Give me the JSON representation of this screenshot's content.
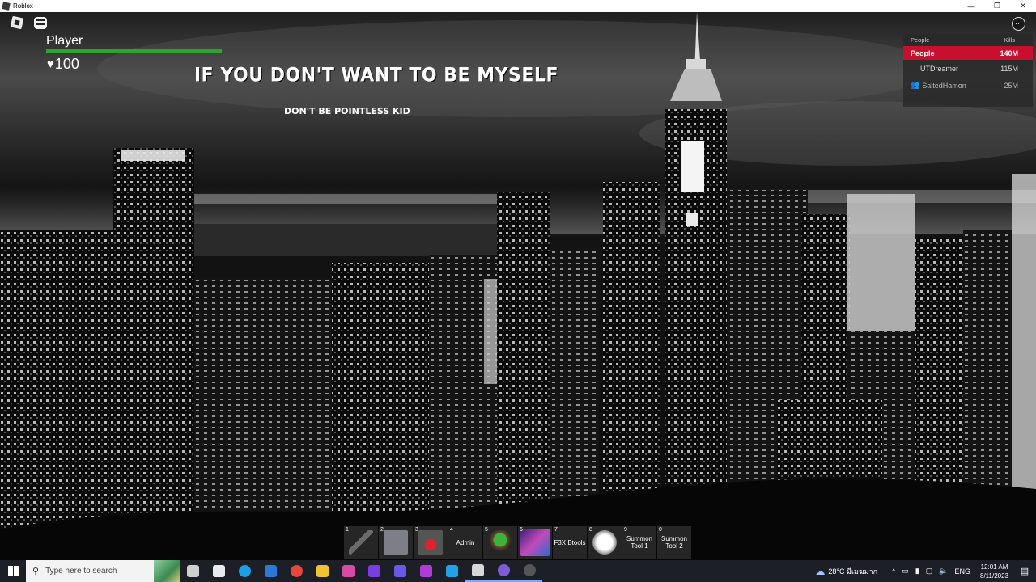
{
  "window": {
    "title": "Roblox",
    "minimize": "—",
    "restore": "❐",
    "close": "✕"
  },
  "hud": {
    "player_name": "Player",
    "health_value": "100",
    "health_fraction": 1.0,
    "heart": "♥",
    "headline": "IF YOU DON'T WANT TO BE MYSELF",
    "subline": "DON'T BE POINTLESS KID",
    "more_icon": "⋯"
  },
  "leaderboard": {
    "col_player": "People",
    "col_stat": "Kills",
    "rows": [
      {
        "name": "People",
        "value": "140M",
        "self": true
      },
      {
        "name": "UTDreamer",
        "value": "115M"
      },
      {
        "name": "SaltedHamon",
        "value": "25M",
        "friend_icon": "friends-icon"
      }
    ]
  },
  "hotbar": [
    {
      "num": "1",
      "label": "",
      "art": "#6b6b6b"
    },
    {
      "num": "2",
      "label": "",
      "art": "#7e7e86"
    },
    {
      "num": "3",
      "label": "",
      "art": "#b31e2a"
    },
    {
      "num": "4",
      "label": "Admin",
      "art": ""
    },
    {
      "num": "5",
      "label": "",
      "art": "#3a7a2e"
    },
    {
      "num": "6",
      "label": "",
      "art": "#a23ca8"
    },
    {
      "num": "7",
      "label": "F3X Btools",
      "art": ""
    },
    {
      "num": "8",
      "label": "",
      "art": "#f4f4f4"
    },
    {
      "num": "9",
      "label": "Summon Tool 1",
      "art": ""
    },
    {
      "num": "0",
      "label": "Summon Tool 2",
      "art": ""
    }
  ],
  "taskbar": {
    "search_placeholder": "Type here to search",
    "apps": [
      {
        "name": "task-view",
        "color": "#cfcfcf"
      },
      {
        "name": "microsoft-store",
        "color": "#e9e9e9"
      },
      {
        "name": "edge",
        "color": "#1aa0e6"
      },
      {
        "name": "mail",
        "color": "#2a7ad9"
      },
      {
        "name": "chrome",
        "color": "#e8453c"
      },
      {
        "name": "file-explorer",
        "color": "#f2c233"
      },
      {
        "name": "color-drop-app",
        "color": "#d94aa7"
      },
      {
        "name": "video-editor",
        "color": "#7a3ee0"
      },
      {
        "name": "media-player",
        "color": "#6a5ae8"
      },
      {
        "name": "purple-app",
        "color": "#b03cd8"
      },
      {
        "name": "roblox-studio",
        "color": "#21a2e8"
      },
      {
        "name": "roblox",
        "color": "#d8d8d8"
      },
      {
        "name": "discord-like",
        "color": "#7b5cd6"
      },
      {
        "name": "obs",
        "color": "#555555"
      }
    ],
    "weather": "28°C มีเมฆมาก",
    "lang": "ENG",
    "time": "12:01 AM",
    "date": "8/11/2023",
    "tray_chevron": "^"
  }
}
